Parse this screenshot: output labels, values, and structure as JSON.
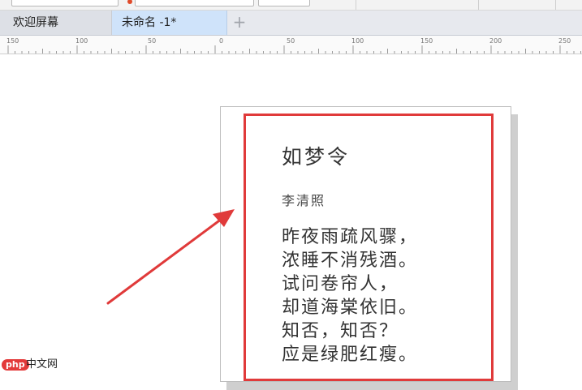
{
  "tabs": {
    "welcome_label": "欢迎屏幕",
    "document_label": "未命名 -1*",
    "add_icon": "plus-icon"
  },
  "ruler": {
    "labels": [
      "150",
      "100",
      "50",
      "0",
      "50",
      "100",
      "150",
      "200",
      "250"
    ]
  },
  "poem": {
    "title": "如梦令",
    "author": "李清照",
    "lines": [
      "昨夜雨疏风骤，",
      "浓睡不消残酒。",
      "试问卷帘人，",
      "却道海棠依旧。",
      "知否，知否？",
      "应是绿肥红瘦。"
    ]
  },
  "annotation": {
    "frame_color": "#e03a3a",
    "arrow_color": "#e03a3a"
  },
  "watermark": {
    "logo": "php",
    "text": "中文网"
  }
}
